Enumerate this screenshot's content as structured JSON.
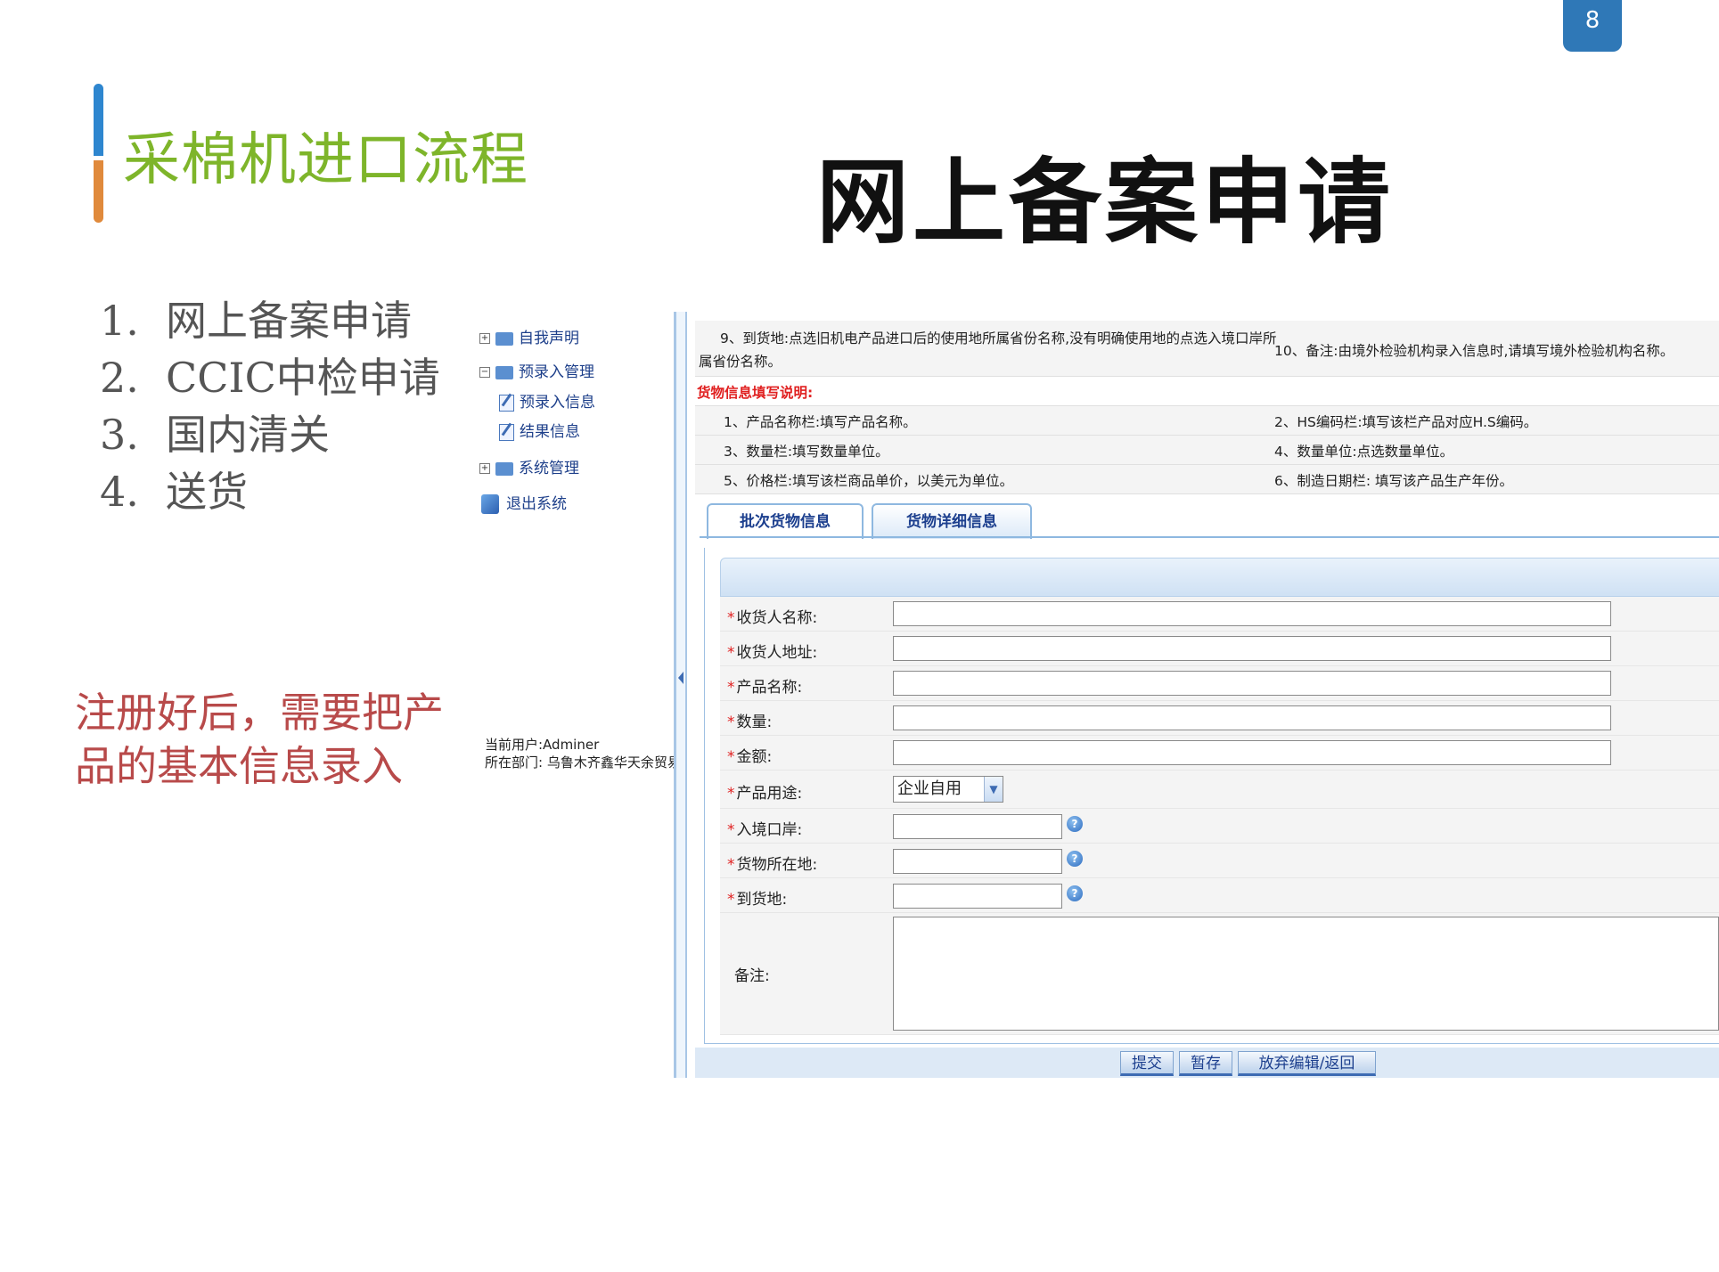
{
  "slide": {
    "page_number": "8",
    "section_title": "采棉机进口流程",
    "main_title": "网上备案申请",
    "steps": [
      {
        "num": "1.",
        "label": "网上备案申请"
      },
      {
        "num": "2.",
        "label": "CCIC中检申请"
      },
      {
        "num": "3.",
        "label": "国内清关"
      },
      {
        "num": "4.",
        "label": "送货"
      }
    ],
    "note": "注册好后，需要把产品的基本信息录入"
  },
  "sidebar": {
    "items": [
      {
        "label": "自我声明",
        "kind": "folder",
        "expander": "+"
      },
      {
        "label": "预录入管理",
        "kind": "folder",
        "expander": "−"
      },
      {
        "label": "预录入信息",
        "kind": "doc"
      },
      {
        "label": "结果信息",
        "kind": "doc"
      },
      {
        "label": "系统管理",
        "kind": "folder",
        "expander": "+"
      },
      {
        "label": "退出系统",
        "kind": "exit"
      }
    ],
    "current_user": "当前用户:Adminer",
    "department": "所在部门: 乌鲁木齐鑫华天余贸易"
  },
  "instructions": {
    "item9_line1": "9、到货地:点选旧机电产品进口后的使用地所属省份名称,没有明确使用地的点选入境口岸所",
    "item9_line2": "属省份名称。",
    "item10": "10、备注:由境外检验机构录入信息时,请填写境外检验机构名称。",
    "goods_header": "货物信息填写说明:",
    "rows": [
      {
        "left": "1、产品名称栏:填写产品名称。",
        "right": "2、HS编码栏:填写该栏产品对应H.S编码。"
      },
      {
        "left": "3、数量栏:填写数量单位。",
        "right": "4、数量单位:点选数量单位。"
      },
      {
        "left": "5、价格栏:填写该栏商品单价，以美元为单位。",
        "right": "6、制造日期栏: 填写该产品生产年份。"
      }
    ]
  },
  "tabs": [
    {
      "label": "批次货物信息",
      "active": true
    },
    {
      "label": "货物详细信息",
      "active": false
    }
  ],
  "form": {
    "consignee_name": {
      "label": "收货人名称:",
      "value": ""
    },
    "consignee_address": {
      "label": "收货人地址:",
      "value": ""
    },
    "product_name": {
      "label": "产品名称:",
      "value": ""
    },
    "quantity": {
      "label": "数量:",
      "value": ""
    },
    "amount": {
      "label": "金额:",
      "value": ""
    },
    "usage": {
      "label": "产品用途:",
      "value": "企业自用"
    },
    "entry_port": {
      "label": "入境口岸:",
      "value": ""
    },
    "goods_location": {
      "label": "货物所在地:",
      "value": ""
    },
    "destination": {
      "label": "到货地:",
      "value": ""
    },
    "remarks": {
      "label": "备注:",
      "value": ""
    },
    "required_mark": "*",
    "help_glyph": "?"
  },
  "buttons": {
    "submit": "提交",
    "save_draft": "暂存",
    "abandon": "放弃编辑/返回"
  },
  "colors": {
    "section_title": "#7eb52a",
    "note": "#b84a4a",
    "badge": "#2f78b7",
    "required": "#e02020",
    "link_blue": "#1c3f8e"
  }
}
